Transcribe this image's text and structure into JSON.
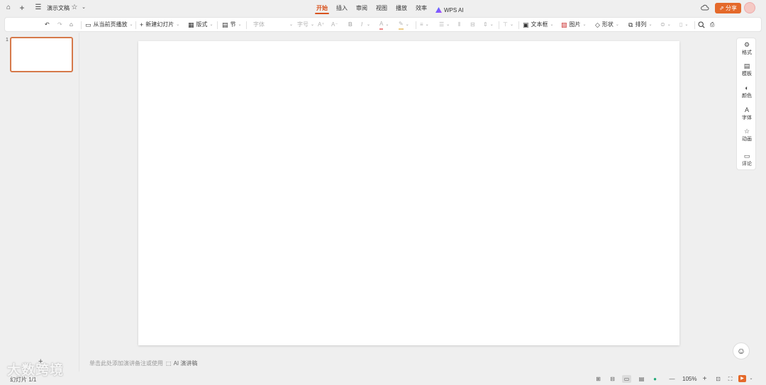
{
  "titlebar": {
    "doc_title": "演示文稿",
    "tabs": [
      "开始",
      "插入",
      "审阅",
      "视图",
      "播放",
      "效率"
    ],
    "ai_tab": "WPS AI",
    "share_label": "分享"
  },
  "ribbon": {
    "play_from_current": "从当前页播放",
    "new_slide": "新建幻灯片",
    "layout": "版式",
    "section": "节",
    "font_placeholder": "字体",
    "font_size": "字号",
    "text_box": "文本框",
    "picture": "图片",
    "shape": "形状",
    "arrange": "排列"
  },
  "thumbnails": [
    {
      "number": "1"
    }
  ],
  "sidepanel": [
    {
      "label": "格式",
      "icon": "gear-icon"
    },
    {
      "label": "模板",
      "icon": "template-icon"
    },
    {
      "label": "颜色",
      "icon": "palette-icon"
    },
    {
      "label": "字体",
      "icon": "font-icon"
    },
    {
      "label": "动画",
      "icon": "star-icon"
    },
    {
      "label": "评论",
      "icon": "comment-icon"
    }
  ],
  "notes": {
    "placeholder": "单击此处添加演讲备注或使用",
    "ai_notes": "AI 演讲稿"
  },
  "statusbar": {
    "slide_count": "幻灯片 1/1",
    "zoom": "105%"
  },
  "watermark": "大数跨境"
}
